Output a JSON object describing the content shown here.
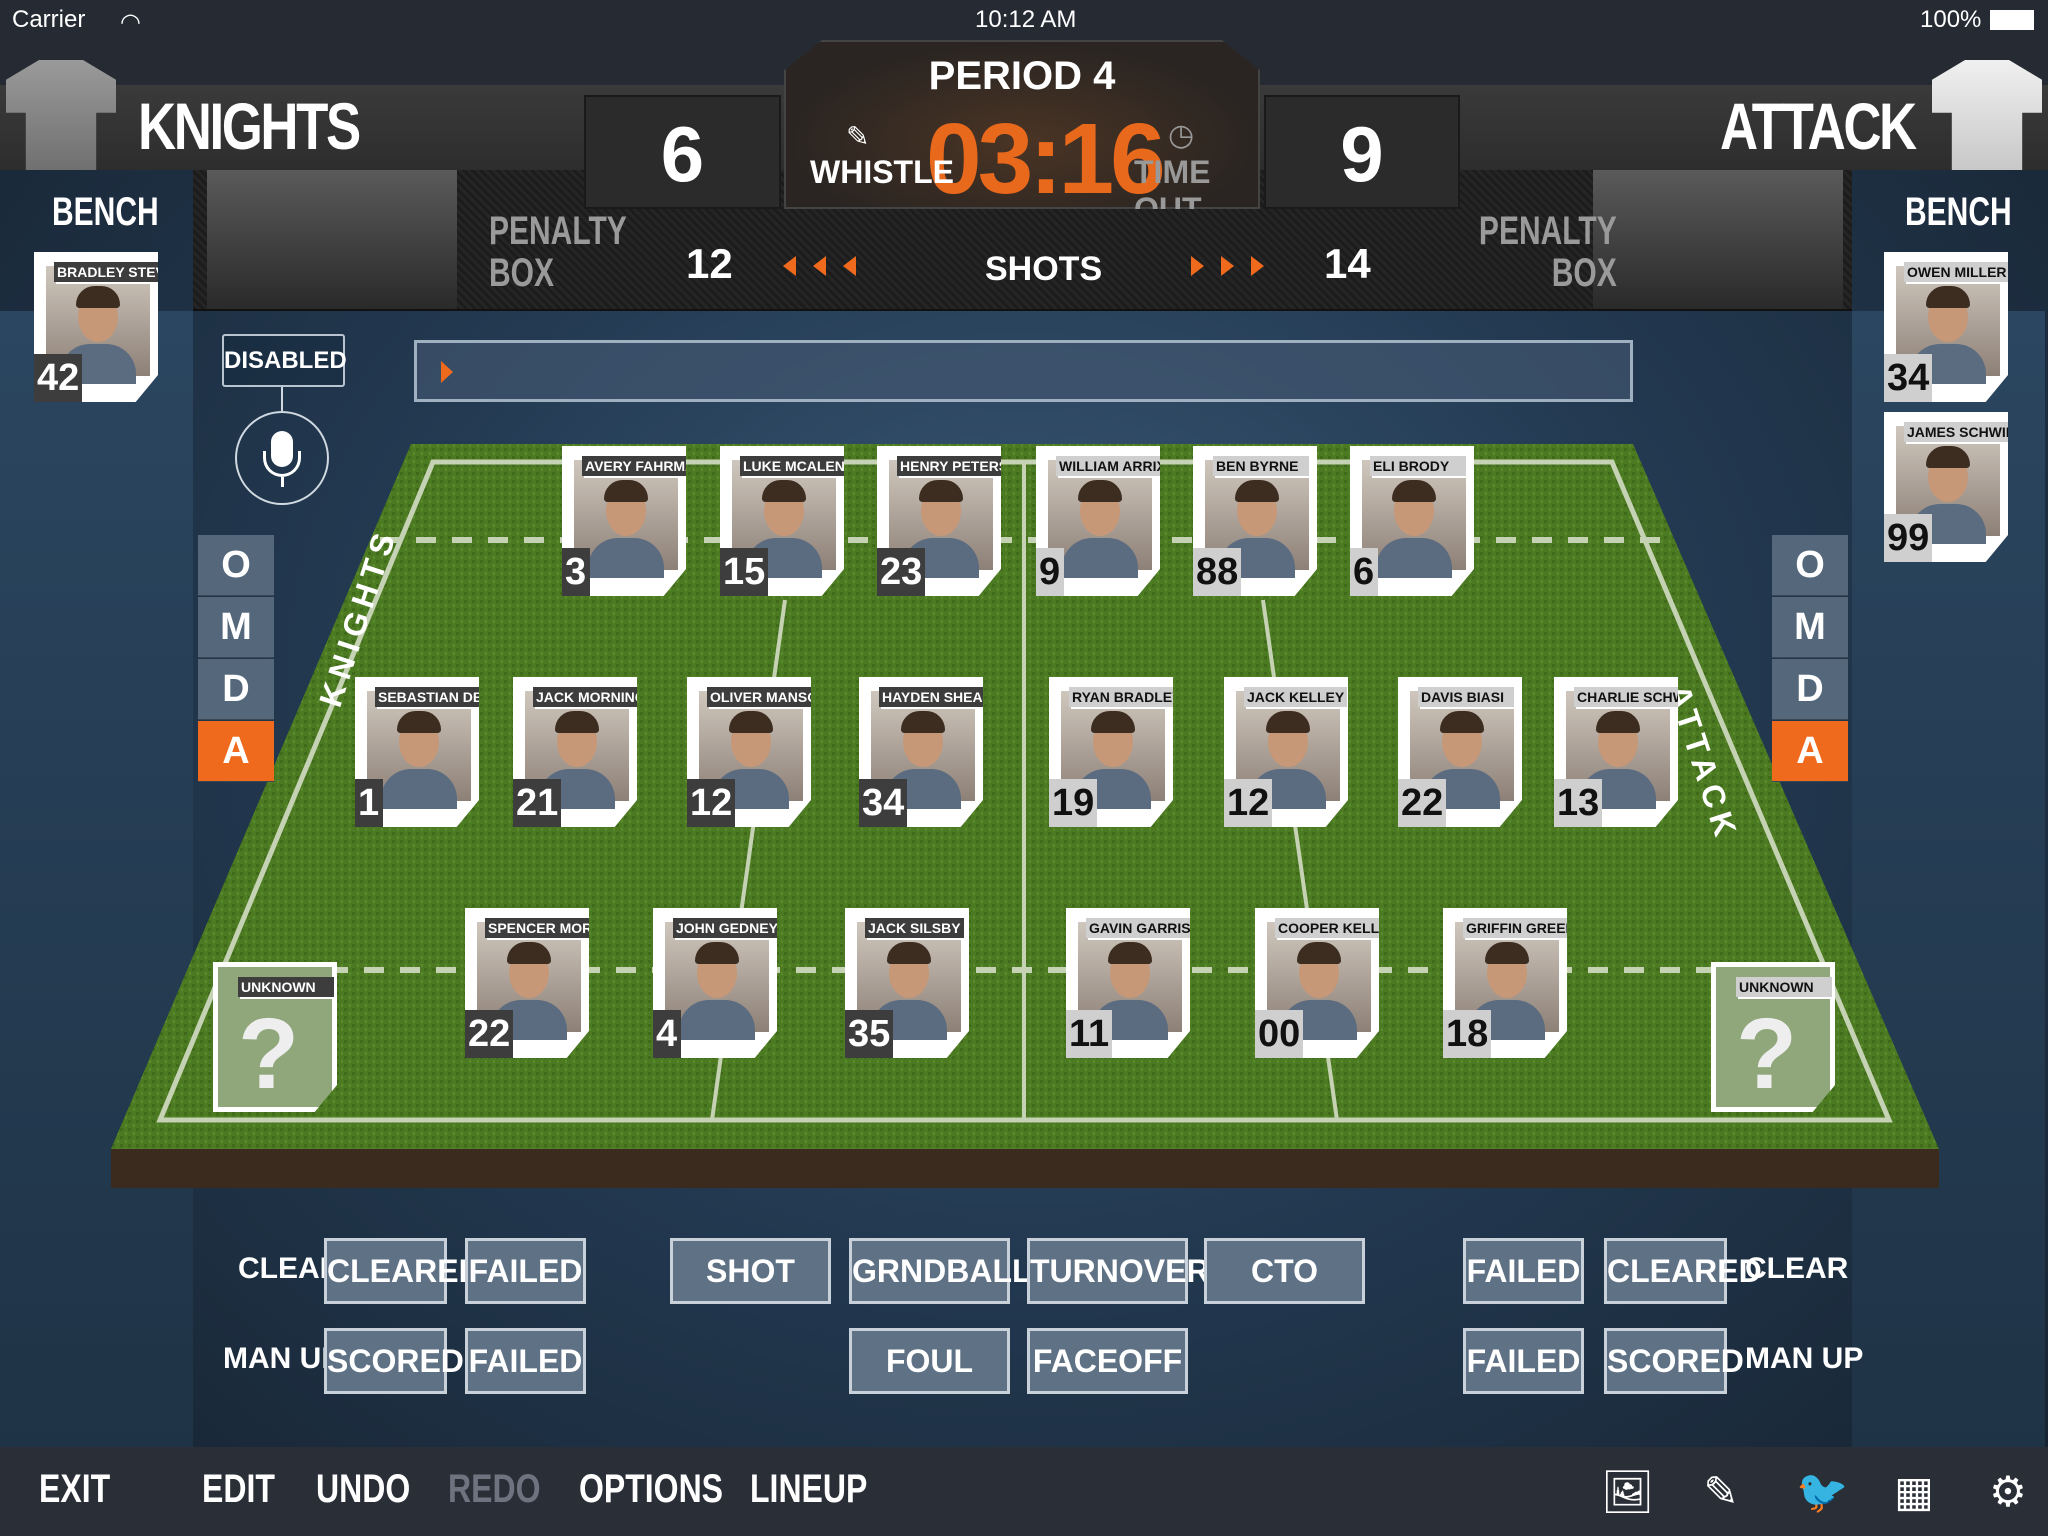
{
  "status_bar": {
    "carrier": "Carrier",
    "time": "10:12 AM",
    "battery": "100%"
  },
  "scoreboard": {
    "home_team": "KNIGHTS",
    "away_team": "ATTACK",
    "home_score": "6",
    "away_score": "9",
    "period": "PERIOD 4",
    "clock": "03:16",
    "whistle_label": "WHISTLE",
    "timeout_label": "TIME OUT",
    "penalty_box_left": [
      "PENALTY",
      "BOX"
    ],
    "penalty_box_right": [
      "PENALTY",
      "BOX"
    ],
    "home_shots": "12",
    "away_shots": "14",
    "shots_label": "SHOTS"
  },
  "colors": {
    "accent": "#ef6a1c",
    "clock": "#e8681c",
    "button": "#5f7184"
  },
  "bench": {
    "title": "BENCH",
    "home": [
      {
        "name": "BRADLEY STEVENS",
        "number": "42"
      }
    ],
    "away": [
      {
        "name": "OWEN MILLER",
        "number": "34"
      },
      {
        "name": "JAMES SCHWIND",
        "number": "99"
      }
    ]
  },
  "voice": {
    "status": "DISABLED",
    "icon": "microphone-icon"
  },
  "command_input": {
    "value": ""
  },
  "position_filters": {
    "items": [
      "O",
      "M",
      "D",
      "A"
    ],
    "selected": "A"
  },
  "field": {
    "home_label": "KNIGHTS",
    "away_label": "ATTACK",
    "home_rows": [
      [
        {
          "name": "AVERY FAHRMAN",
          "number": "3"
        },
        {
          "name": "LUKE MCALENNEY",
          "number": "15"
        },
        {
          "name": "HENRY PETERS",
          "number": "23"
        }
      ],
      [
        {
          "name": "SEBASTIAN DEANGELIS",
          "number": "1"
        },
        {
          "name": "JACK MORNINGSTAR",
          "number": "21"
        },
        {
          "name": "OLIVER MANSOURIAN",
          "number": "12"
        },
        {
          "name": "HAYDEN SHEA",
          "number": "34"
        }
      ],
      [
        {
          "name": "SPENCER MORROW",
          "number": "22"
        },
        {
          "name": "JOHN GEDNEY",
          "number": "4"
        },
        {
          "name": "JACK SILSBY",
          "number": "35"
        }
      ]
    ],
    "away_rows": [
      [
        {
          "name": "WILLIAM ARRIX",
          "number": "9"
        },
        {
          "name": "BEN BYRNE",
          "number": "88"
        },
        {
          "name": "ELI BRODY",
          "number": "6"
        }
      ],
      [
        {
          "name": "RYAN BRADLEY",
          "number": "19"
        },
        {
          "name": "JACK KELLEY",
          "number": "12"
        },
        {
          "name": "DAVIS BIASI",
          "number": "22"
        },
        {
          "name": "CHARLIE SCHWIND",
          "number": "13"
        }
      ],
      [
        {
          "name": "GAVIN GARRISON",
          "number": "11"
        },
        {
          "name": "COOPER KELLEY",
          "number": "00"
        },
        {
          "name": "GRIFFIN GREEN",
          "number": "18"
        }
      ]
    ],
    "home_goalie": {
      "name": "UNKNOWN",
      "number": "?"
    },
    "away_goalie": {
      "name": "UNKNOWN",
      "number": "?"
    }
  },
  "actions": {
    "left": {
      "clear_label": "CLEAR",
      "clear_buttons": [
        "CLEARED",
        "FAILED"
      ],
      "manup_label": "MAN UP",
      "manup_buttons": [
        "SCORED",
        "FAILED"
      ]
    },
    "center_row1": [
      "SHOT",
      "GRNDBALL",
      "TURNOVER",
      "CTO"
    ],
    "center_row2": [
      "FOUL",
      "FACEOFF"
    ],
    "right": {
      "clear_label": "CLEAR",
      "clear_buttons": [
        "FAILED",
        "CLEARED"
      ],
      "manup_label": "MAN UP",
      "manup_buttons": [
        "FAILED",
        "SCORED"
      ]
    }
  },
  "bottom_bar": {
    "items": [
      {
        "label": "EXIT",
        "enabled": true
      },
      {
        "label": "EDIT",
        "enabled": true
      },
      {
        "label": "UNDO",
        "enabled": true
      },
      {
        "label": "REDO",
        "enabled": false
      },
      {
        "label": "OPTIONS",
        "enabled": true
      },
      {
        "label": "LINEUP",
        "enabled": true
      }
    ],
    "icons": [
      "image-icon",
      "edit-note-icon",
      "twitter-icon",
      "grid-icon",
      "gear-icon"
    ]
  }
}
